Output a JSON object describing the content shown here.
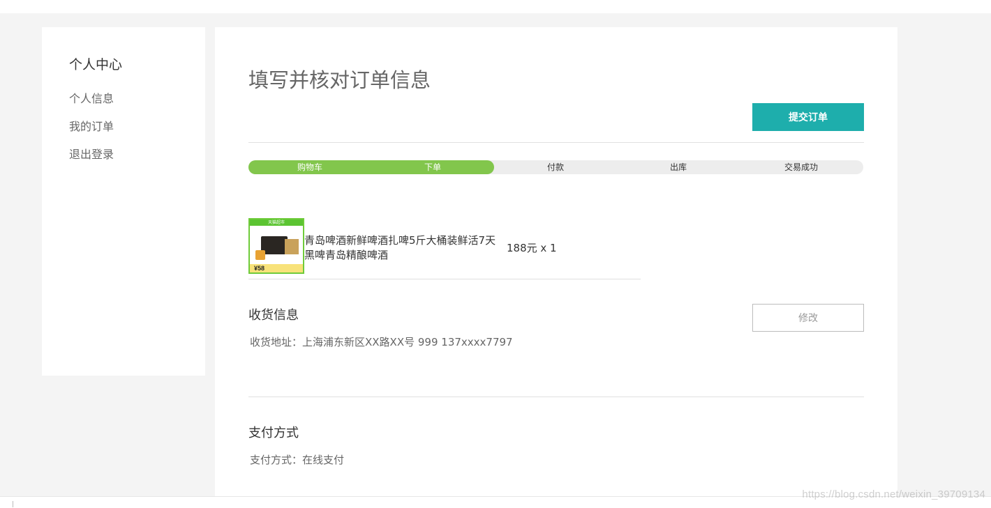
{
  "sidebar": {
    "title": "个人中心",
    "items": [
      {
        "label": "个人信息"
      },
      {
        "label": "我的订单"
      },
      {
        "label": "退出登录"
      }
    ]
  },
  "main": {
    "title": "填写并核对订单信息",
    "submit_label": "提交订单",
    "progress": {
      "completed_steps": 2,
      "steps": [
        "购物车",
        "下单",
        "付款",
        "出库",
        "交易成功"
      ]
    },
    "product": {
      "image_banner": "天猫超市",
      "image_price": "¥58",
      "name": "青岛啤酒新鲜啤酒扎啤5斤大桶装鲜活7天黑啤青岛精酿啤酒",
      "price_qty": "188元 x 1"
    },
    "shipping": {
      "title": "收货信息",
      "address": "收货地址：上海浦东新区XX路XX号 999 137xxxx7797",
      "edit_label": "修改"
    },
    "payment": {
      "title": "支付方式",
      "method": "支付方式：在线支付"
    }
  },
  "watermark": "https://blog.csdn.net/weixin_39709134",
  "colors": {
    "accent": "#1eaeac",
    "progress_done": "#82c64c",
    "progress_track": "#ededed",
    "page_bg": "#f4f4f4"
  }
}
